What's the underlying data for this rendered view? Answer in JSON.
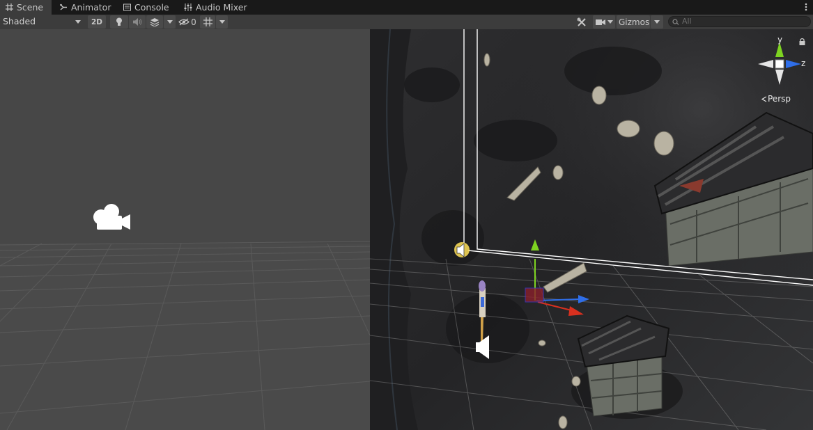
{
  "tabs": [
    {
      "label": "Scene",
      "icon": "grid-icon",
      "active": true
    },
    {
      "label": "Animator",
      "icon": "animator-icon",
      "active": false
    },
    {
      "label": "Console",
      "icon": "console-icon",
      "active": false
    },
    {
      "label": "Audio Mixer",
      "icon": "mixer-icon",
      "active": false
    }
  ],
  "toolbar": {
    "shading_mode": "Shaded",
    "toggle_2d": "2D",
    "hidden_count": "0",
    "gizmos_label": "Gizmos",
    "search_placeholder": "All"
  },
  "viewport": {
    "projection_label": "Persp",
    "axis_y": "y",
    "axis_z": "z"
  },
  "colors": {
    "axis_x": "#d8301f",
    "axis_y": "#7ed321",
    "axis_z": "#2f6ee8",
    "editor_bg": "#3c3c3c"
  }
}
